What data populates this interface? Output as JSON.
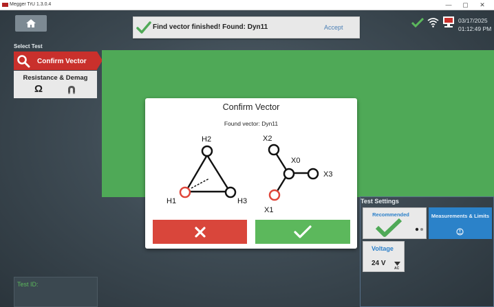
{
  "window": {
    "title": "Megger TrU 1.3.0.4",
    "minimize": "—",
    "maximize": "▢",
    "close": "✕"
  },
  "notification": {
    "message": "Find vector finished! Found: Dyn11",
    "accept_label": "Accept"
  },
  "status": {
    "date": "03/17/2025",
    "time": "01:12:49 PM"
  },
  "select_test": {
    "label": "Select Test",
    "items": [
      {
        "label": "Confirm Vector",
        "active": true,
        "icon": "search-icon"
      },
      {
        "label": "Resistance & Demag",
        "active": false,
        "icons": [
          "omega-icon",
          "magnet-icon"
        ],
        "omega_glyph": "Ω"
      }
    ]
  },
  "test_settings": {
    "label": "Test Settings",
    "recommended_label": "Recommended",
    "measurements_label": "Measurements & Limits",
    "voltage_label": "Voltage",
    "voltage_value": "24 V",
    "voltage_unit": "AC"
  },
  "test_id": {
    "label": "Test ID:"
  },
  "dialog": {
    "title": "Confirm Vector",
    "found_text": "Found vector: Dyn11",
    "hv_nodes": {
      "h1": "H1",
      "h2": "H2",
      "h3": "H3"
    },
    "lv_nodes": {
      "x0": "X0",
      "x1": "X1",
      "x2": "X2",
      "x3": "X3"
    }
  },
  "colors": {
    "accent_green": "#4fa957",
    "confirm_red": "#c9302c",
    "reject_red": "#d9463b",
    "accept_green": "#5cb85c",
    "blue": "#2b82c9"
  }
}
